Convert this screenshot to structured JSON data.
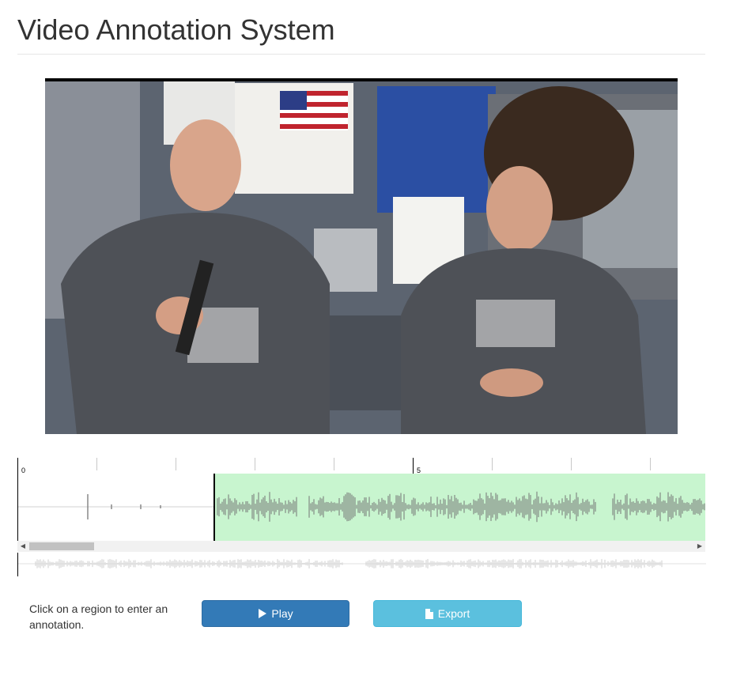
{
  "page": {
    "title": "Video Annotation System"
  },
  "timeline": {
    "tick_labels": [
      "0",
      "5"
    ]
  },
  "instructions": {
    "hint": "Click on a region to enter an annotation."
  },
  "buttons": {
    "play_label": "Play",
    "export_label": "Export"
  },
  "icons": {
    "play": "play-icon",
    "export": "file-icon"
  },
  "colors": {
    "region": "#c8f5cf",
    "waveform": "#8c9a8e",
    "play_button": "#337ab7",
    "export_button": "#5bc0de"
  }
}
